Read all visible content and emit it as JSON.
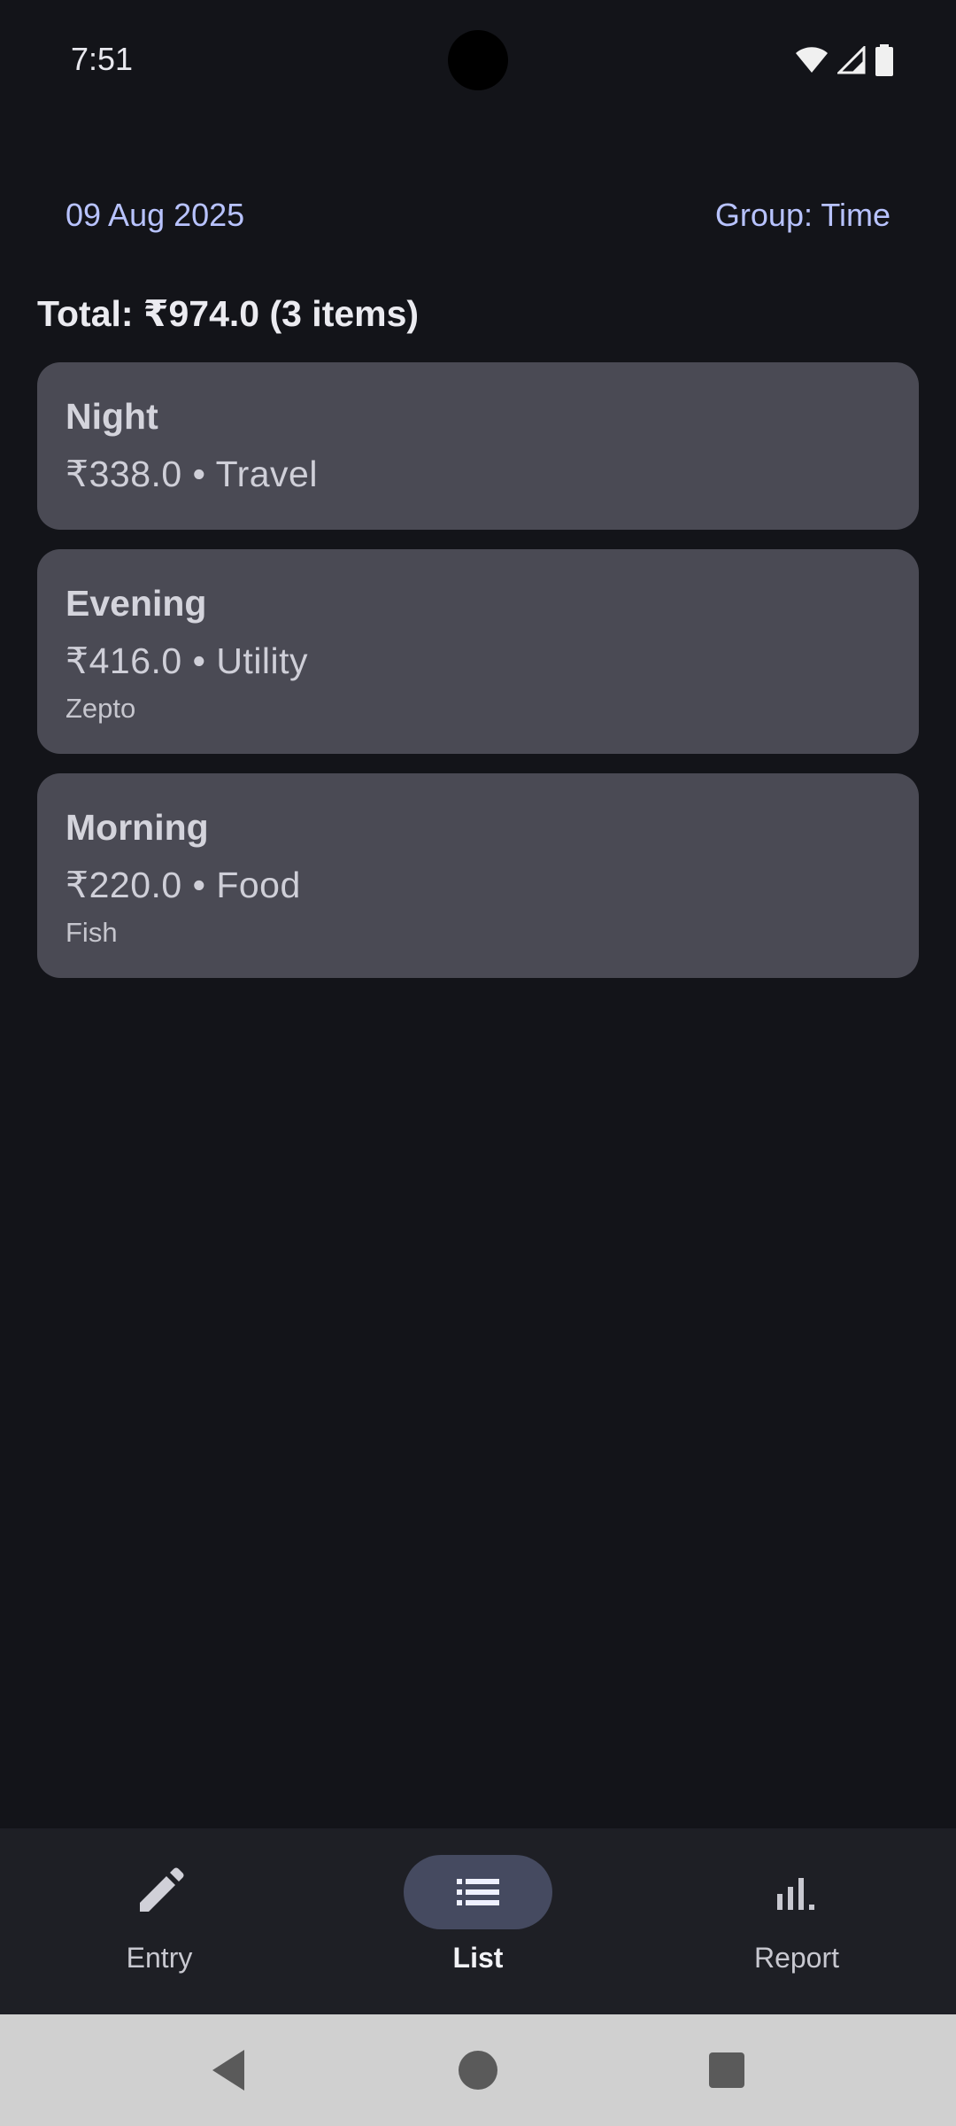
{
  "status_bar": {
    "time": "7:51",
    "icons": [
      "wifi-icon",
      "signal-icon",
      "battery-icon"
    ]
  },
  "header": {
    "date": "09 Aug 2025",
    "group_label": "Group: Time"
  },
  "summary": {
    "total_text": "Total: ₹974.0 (3 items)"
  },
  "entries": [
    {
      "title": "Night",
      "amount_line": "₹338.0 • Travel",
      "note": ""
    },
    {
      "title": "Evening",
      "amount_line": "₹416.0 • Utility",
      "note": "Zepto"
    },
    {
      "title": "Morning",
      "amount_line": "₹220.0 • Food",
      "note": "Fish"
    }
  ],
  "bottom_nav": {
    "items": [
      {
        "label": "Entry",
        "icon": "pencil-icon",
        "active": false
      },
      {
        "label": "List",
        "icon": "list-icon",
        "active": true
      },
      {
        "label": "Report",
        "icon": "bar-chart-icon",
        "active": false
      }
    ]
  },
  "system_nav": {
    "buttons": [
      "back-icon",
      "home-icon",
      "recents-icon"
    ]
  },
  "colors": {
    "background": "#131419",
    "card": "#4a4a54",
    "accent": "#b8c3ff",
    "nav_background": "#1e1f25",
    "nav_active_pill": "#454a60"
  }
}
